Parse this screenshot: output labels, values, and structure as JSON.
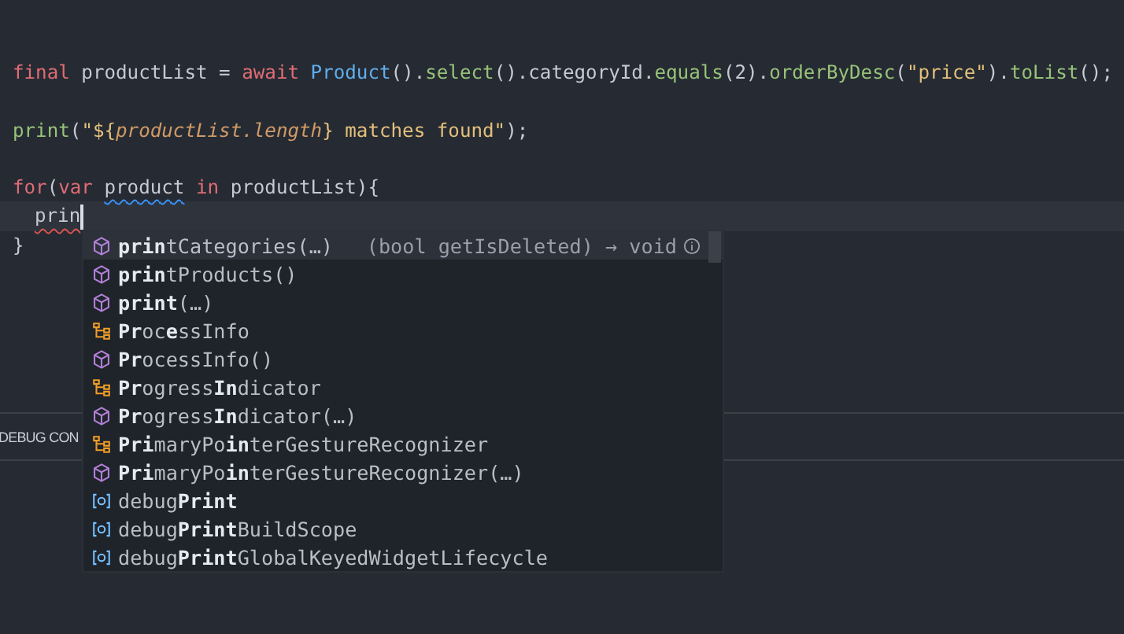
{
  "code": {
    "lines_before": [
      {
        "kind": "code",
        "tokens": [
          {
            "text": "final",
            "kind": "keyword"
          },
          {
            "text": " productList = ",
            "kind": "plain"
          },
          {
            "text": "await",
            "kind": "keyword"
          },
          {
            "text": " Product",
            "kind": "type"
          },
          {
            "text": "().",
            "kind": "plain"
          },
          {
            "text": "select",
            "kind": "method"
          },
          {
            "text": "().categoryId.",
            "kind": "plain"
          },
          {
            "text": "equals",
            "kind": "method"
          },
          {
            "text": "(2).",
            "kind": "plain"
          },
          {
            "text": "orderByDesc",
            "kind": "method"
          },
          {
            "text": "(",
            "kind": "plain"
          },
          {
            "text": "\"price\"",
            "kind": "string"
          },
          {
            "text": ").",
            "kind": "plain"
          },
          {
            "text": "toList",
            "kind": "method"
          },
          {
            "text": "();",
            "kind": "plain"
          }
        ]
      },
      {
        "kind": "blank"
      },
      {
        "kind": "code",
        "tokens": [
          {
            "text": "print",
            "kind": "method"
          },
          {
            "text": "(",
            "kind": "plain"
          },
          {
            "text": "\"${",
            "kind": "string"
          },
          {
            "text": "productList.length",
            "kind": "interpolation"
          },
          {
            "text": "} matches found\"",
            "kind": "string"
          },
          {
            "text": ");",
            "kind": "plain"
          }
        ]
      },
      {
        "kind": "blank"
      },
      {
        "kind": "code",
        "tokens": [
          {
            "text": "for",
            "kind": "keyword"
          },
          {
            "text": "(",
            "kind": "plain"
          },
          {
            "text": "var ",
            "kind": "keyword"
          },
          {
            "text": "product",
            "kind": "plain",
            "warning": true
          },
          {
            "text": " in",
            "kind": "keyword"
          },
          {
            "text": " productList){",
            "kind": "plain"
          }
        ]
      }
    ],
    "current_line": {
      "tokens": [
        {
          "text": "prin",
          "kind": "plain",
          "error": true
        }
      ]
    },
    "lines_after": [
      {
        "kind": "code",
        "tokens": [
          {
            "text": "}",
            "kind": "plain"
          }
        ]
      }
    ]
  },
  "panel": {
    "tab": "DEBUG CON"
  },
  "suggestions": [
    {
      "label": "**prin**tCategories(…)",
      "kind": "method",
      "selected": true,
      "detail": "(bool getIsDeleted) → void"
    },
    {
      "label": "**prin**tProducts()",
      "kind": "method",
      "selected": false
    },
    {
      "label": "**print**(…)",
      "kind": "method",
      "selected": false
    },
    {
      "label": "**Pr**oc**e**ssInfo",
      "kind": "class",
      "selected": false
    },
    {
      "label": "**Pr**ocessInfo()",
      "kind": "method",
      "selected": false
    },
    {
      "label": "**Pr**ogress**In**dicator",
      "kind": "class",
      "selected": false
    },
    {
      "label": "**Pr**ogress**In**dicator(…)",
      "kind": "method",
      "selected": false
    },
    {
      "label": "**Pri**maryPo**in**terGestureRecognizer",
      "kind": "class",
      "selected": false
    },
    {
      "label": "**Pri**maryPo**in**terGestureRecognizer(…)",
      "kind": "method",
      "selected": false
    },
    {
      "label": "debug**Print**",
      "kind": "variable",
      "selected": false
    },
    {
      "label": "debug**Print**BuildScope",
      "kind": "variable",
      "selected": false
    },
    {
      "label": "debug**Print**GlobalKeyedWidgetLifecycle",
      "kind": "variable",
      "selected": false
    }
  ]
}
